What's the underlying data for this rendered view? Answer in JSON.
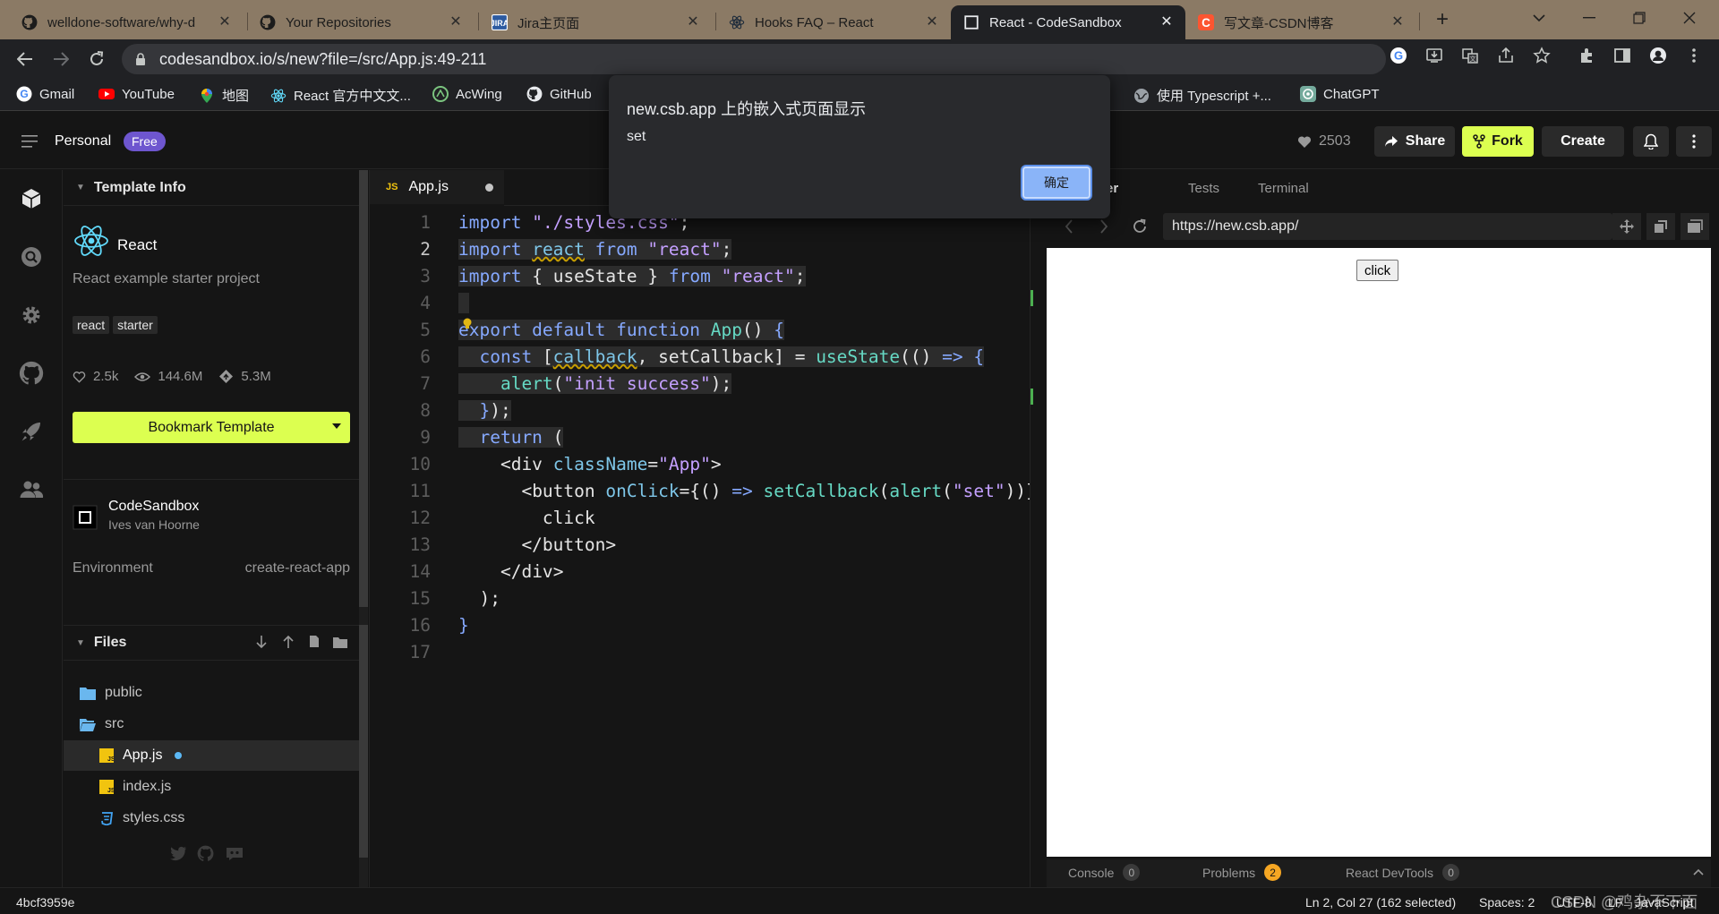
{
  "browser": {
    "tabs": [
      {
        "title": "welldone-software/why-d",
        "close": "✕"
      },
      {
        "title": "Your Repositories",
        "close": "✕"
      },
      {
        "title": "Jira主页面",
        "close": "✕"
      },
      {
        "title": "Hooks FAQ – React",
        "close": "✕"
      },
      {
        "title": "React - CodeSandbox",
        "close": "✕"
      },
      {
        "title": "写文章-CSDN博客",
        "close": "✕"
      }
    ],
    "new_tab": "+",
    "url": "codesandbox.io/s/new?file=/src/App.js:49-211",
    "bookmarks": [
      {
        "label": "Gmail"
      },
      {
        "label": "YouTube"
      },
      {
        "label": "地图"
      },
      {
        "label": "React 官方中文文..."
      },
      {
        "label": "AcWing"
      },
      {
        "label": "GitHub"
      },
      {
        "label": "..."
      },
      {
        "label": "使用 Typescript +..."
      },
      {
        "label": "ChatGPT"
      }
    ]
  },
  "alert": {
    "title": "new.csb.app 上的嵌入式页面显示",
    "message": "set",
    "ok": "确定"
  },
  "header": {
    "workspace": "Personal",
    "plan_badge": "Free",
    "likes": "2503",
    "share": "Share",
    "fork": "Fork",
    "create": "Create"
  },
  "sidebar": {
    "template_info": "Template Info",
    "template_name": "React",
    "template_desc": "React example starter project",
    "tags": [
      "react",
      "starter"
    ],
    "stats": {
      "likes": "2.5k",
      "views": "144.6M",
      "forks": "5.3M"
    },
    "bookmark_btn": "Bookmark Template",
    "author_org": "CodeSandbox",
    "author_name": "Ives van Hoorne",
    "env_label": "Environment",
    "env_value": "create-react-app",
    "files_title": "Files",
    "files": [
      {
        "name": "public",
        "type": "folder"
      },
      {
        "name": "src",
        "type": "folder-open"
      },
      {
        "name": "App.js",
        "type": "js"
      },
      {
        "name": "index.js",
        "type": "js"
      },
      {
        "name": "styles.css",
        "type": "css"
      }
    ]
  },
  "editor": {
    "tab": "App.js",
    "tab_badge": "JS",
    "line_numbers": [
      "1",
      "2",
      "3",
      "4",
      "5",
      "6",
      "7",
      "8",
      "9",
      "10",
      "11",
      "12",
      "13",
      "14",
      "15",
      "16",
      "17"
    ]
  },
  "preview": {
    "tabs": [
      "er",
      "Tests",
      "Terminal"
    ],
    "url": "https://new.csb.app/",
    "button": "click",
    "bottom": [
      {
        "label": "Console",
        "count": "0"
      },
      {
        "label": "Problems",
        "count": "2"
      },
      {
        "label": "React DevTools",
        "count": "0"
      }
    ]
  },
  "status": {
    "commit": "4bcf3959e",
    "position": "Ln 2, Col 27 (162 selected)",
    "spaces": "Spaces: 2",
    "encoding": "UTF-8",
    "eol": "LF",
    "language": "JavaScript",
    "watermark": "CSDN @鸡杂不下面"
  },
  "colors": {
    "accent_lime": "#dcff50",
    "badge_purple": "#6e56cf",
    "problems_orange": "#f5a623"
  }
}
